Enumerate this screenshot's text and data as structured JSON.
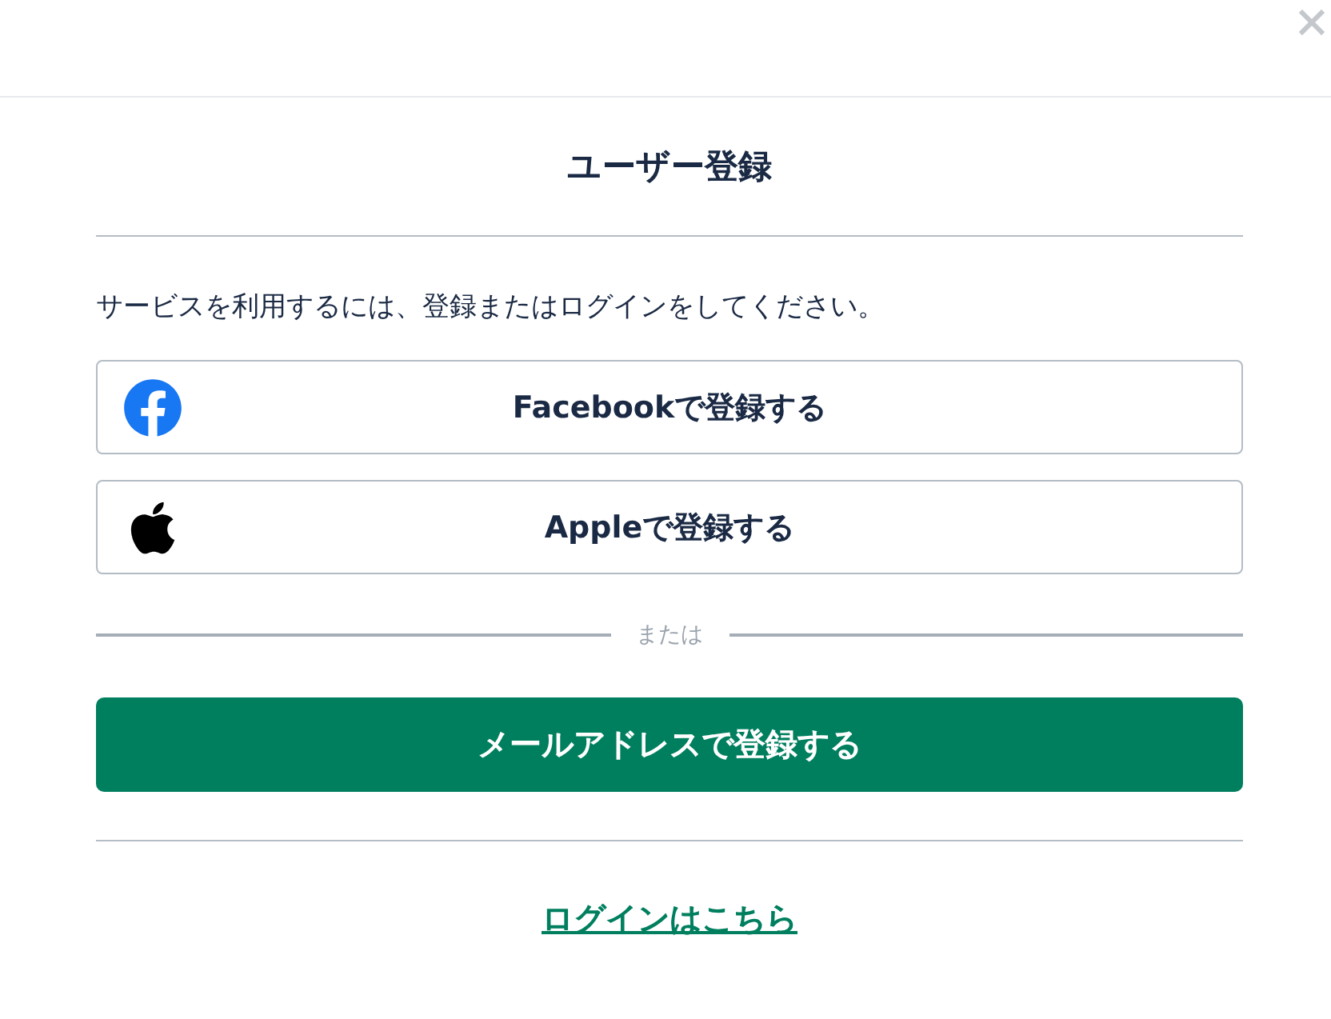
{
  "title": "ユーザー登録",
  "description": "サービスを利用するには、登録またはログインをしてください。",
  "social_buttons": [
    {
      "kind": "facebook",
      "label": "Facebookで登録する"
    },
    {
      "kind": "apple",
      "label": "Appleで登録する"
    }
  ],
  "separator": "または",
  "email_button": "メールアドレスで登録する",
  "login_link": "ログインはこちら"
}
